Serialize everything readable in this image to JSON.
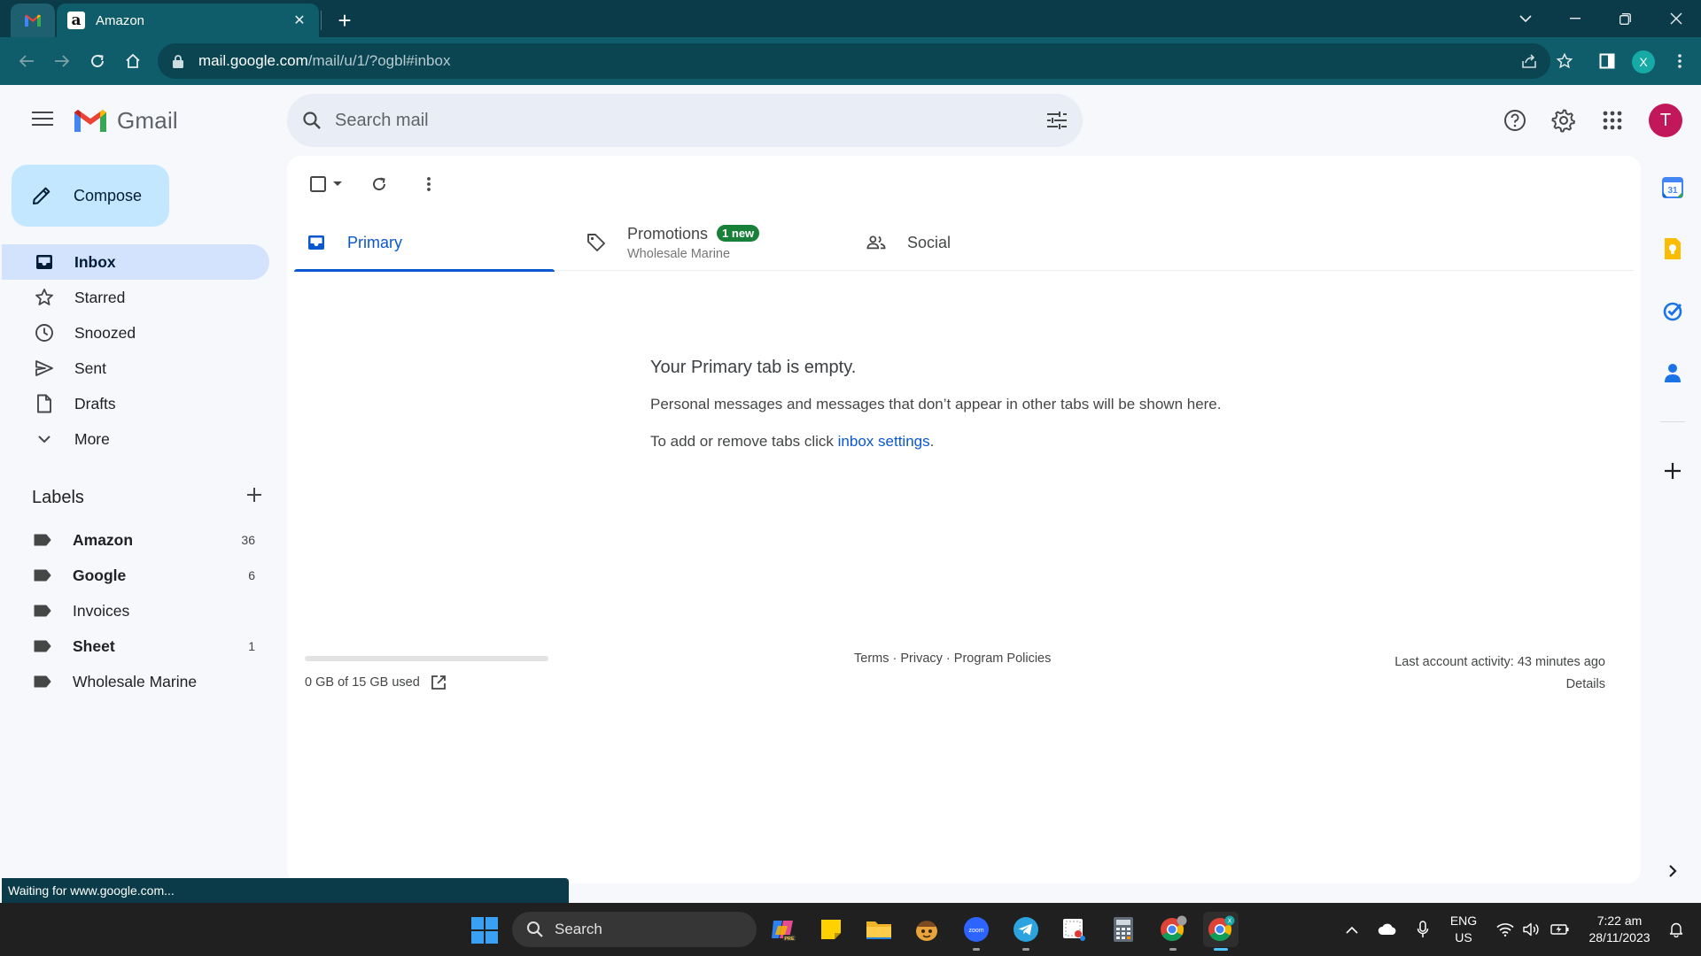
{
  "browser": {
    "tab_title": "Amazon",
    "url_host": "mail.google.com",
    "url_path": "/mail/u/1/?ogbl#inbox",
    "profile_initial": "X"
  },
  "gmail": {
    "app_name": "Gmail",
    "search_placeholder": "Search mail",
    "avatar_initial": "T",
    "compose_label": "Compose"
  },
  "sidebar": {
    "items": [
      {
        "label": "Inbox",
        "icon": "inbox-icon",
        "active": true
      },
      {
        "label": "Starred",
        "icon": "star-icon"
      },
      {
        "label": "Snoozed",
        "icon": "clock-icon"
      },
      {
        "label": "Sent",
        "icon": "send-icon"
      },
      {
        "label": "Drafts",
        "icon": "draft-icon"
      },
      {
        "label": "More",
        "icon": "chevron-down-icon"
      }
    ],
    "labels_title": "Labels",
    "labels": [
      {
        "name": "Amazon",
        "count": "36",
        "bold": true
      },
      {
        "name": "Google",
        "count": "6",
        "bold": true
      },
      {
        "name": "Invoices",
        "count": "",
        "bold": false
      },
      {
        "name": "Sheet",
        "count": "1",
        "bold": true
      },
      {
        "name": "Wholesale Marine",
        "count": "",
        "bold": false
      }
    ]
  },
  "tabs": {
    "primary": "Primary",
    "promotions": "Promotions",
    "promotions_badge": "1 new",
    "promotions_sub": "Wholesale Marine",
    "social": "Social"
  },
  "empty_state": {
    "title": "Your Primary tab is empty.",
    "line1": "Personal messages and messages that don’t appear in other tabs will be shown here.",
    "line2_prefix": "To add or remove tabs click ",
    "line2_link": "inbox settings",
    "line2_suffix": "."
  },
  "footer": {
    "storage": "0 GB of 15 GB used",
    "storage_fraction": 0.0,
    "links": "Terms · Privacy · Program Policies",
    "activity": "Last account activity: 43 minutes ago",
    "details": "Details"
  },
  "status_text": "Waiting for www.google.com...",
  "taskbar": {
    "search_label": "Search",
    "lang_line1": "ENG",
    "lang_line2": "US",
    "time": "7:22 am",
    "date": "28/11/2023"
  },
  "colors": {
    "chrome_dark": "#0b3b49",
    "chrome_toolbar": "#0f5d6a",
    "gmail_bg": "#f6f8fc",
    "compose_bg": "#c2e7ff",
    "active_nav": "#d3e3fd",
    "primary_blue": "#0b57d0",
    "badge_green": "#188038",
    "avatar": "#c2185b"
  }
}
